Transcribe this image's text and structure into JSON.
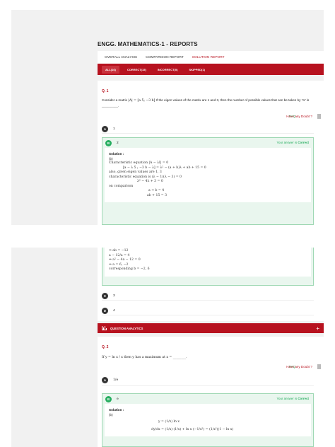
{
  "page_title": "ENGG. MATHEMATICS-1 - REPORTS",
  "tabs": [
    "OVERALL ANALYSIS",
    "COMPARISON REPORT",
    "SOLUTION REPORT"
  ],
  "filters": [
    "ALL(16)",
    "CORRECT(15)",
    "INCORRECT(0)",
    "SKIPPED(1)"
  ],
  "faq_label": "FAQ",
  "doubt_label": "Have any Doubt ?",
  "q1": {
    "number": "Q. 1",
    "text_prefix": "Consider a matrix",
    "matrix": "|A| = [a 5; −3 b]",
    "text_suffix": "If the eigen values of the matrix are 1 and 3, then the number of possible values that can be taken by \"a\" is _________.",
    "options": [
      {
        "letter": "A",
        "value": "1"
      },
      {
        "letter": "B",
        "value": "2"
      },
      {
        "letter": "C",
        "value": "3"
      },
      {
        "letter": "D",
        "value": "4"
      }
    ],
    "answer_note": "Your answer is",
    "answer_status": "Correct",
    "solution_label": "Solution :",
    "solution_key": "(b)",
    "solution_lines": [
      "Characteristic equation |A − λI| = 0",
      "[a − λ   5 ; −3   b − λ] = λ² − (a + b)λ + ab + 15 = 0",
      "also, given eigen values are 1, 3",
      "characteristic equation is (λ − 1)(λ − 3) = 0",
      "λ² − 4λ + 3 = 0",
      "on comparison",
      "a + b = 4",
      "ab + 15 = 3"
    ],
    "solution_continued": [
      "⇒                     ab = −12",
      "              a − 12/a = 4",
      "⇒           a² − 4a − 12 = 0",
      "⇒                    a = 6, −2",
      "       corresponding   b = −2, 6"
    ],
    "analytics_label": "QUESTION ANALYTICS",
    "analytics_plus": "+"
  },
  "q2": {
    "number": "Q. 2",
    "text": "If y = ln x / x then y has a maximum at x = ________.",
    "options": [
      {
        "letter": "A",
        "value": "1/e"
      },
      {
        "letter": "B",
        "value": "e"
      }
    ],
    "answer_note": "Your answer is",
    "answer_status": "Correct",
    "solution_label": "Solution :",
    "solution_key": "(b)",
    "solution_lines": [
      "y = (1/x) ln x",
      "dy/dx = (1/x)·(1/x) + ln x (−1/x²) = (1/x²)(1 − ln x)"
    ]
  }
}
